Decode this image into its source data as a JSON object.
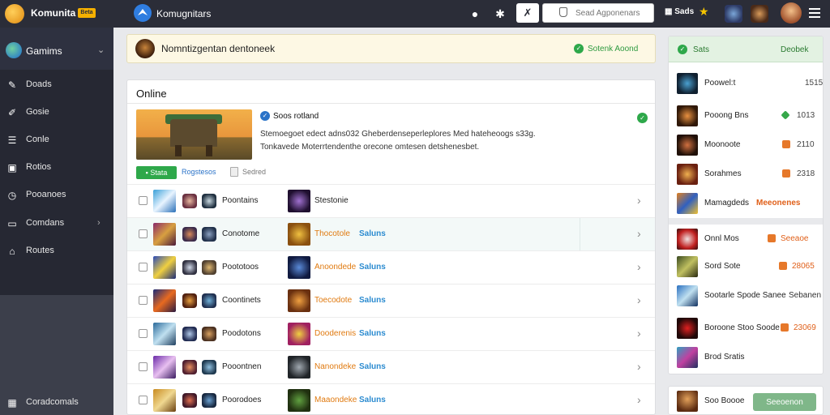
{
  "topbar": {
    "brand": "Komunita",
    "brand_badge": "Beta",
    "app_title": "Komugnitars",
    "search_placeholder": "Sead Agponenars",
    "stats_label": "Sads"
  },
  "sidebar": {
    "header_label": "Gamims",
    "items": [
      {
        "label": "Doads"
      },
      {
        "label": "Gosie"
      },
      {
        "label": "Conle"
      },
      {
        "label": "Rotios"
      },
      {
        "label": "Pooanoes"
      },
      {
        "label": "Comdans"
      },
      {
        "label": "Routes"
      }
    ],
    "footer_label": "Coradcomals"
  },
  "banner": {
    "text": "Nomntizgentan dentoneek",
    "status": "Sotenk Aoond"
  },
  "panel": {
    "title": "Online",
    "hero": {
      "title": "Soos rotland",
      "desc_line1": "Stemoegoet edect adns032 Gheberdenseperleplores Med hateheoogs s33g.",
      "desc_line2": "Tonkavede Moterrtendenthe orecone omtesen detshenesbet.",
      "button_label": "Stata",
      "link1": "Rogstesos",
      "link2": "Sedred"
    },
    "rows": [
      {
        "name": "Poontains",
        "category": "Stestonie",
        "tag": ""
      },
      {
        "name": "Conotome",
        "category": "Thocotole",
        "tag": "Saluns"
      },
      {
        "name": "Poototoos",
        "category": "Anoondede",
        "tag": "Saluns"
      },
      {
        "name": "Coontinets",
        "category": "Toecodote",
        "tag": "Saluns"
      },
      {
        "name": "Poodotons",
        "category": "Dooderenis",
        "tag": "Saluns"
      },
      {
        "name": "Pooontnen",
        "category": "Nanondeke",
        "tag": "Saluns"
      },
      {
        "name": "Poorodoes",
        "category": "Maaondeke",
        "tag": "Saluns"
      }
    ]
  },
  "right_panel": {
    "head_label": "Sats",
    "head_action": "Deobek",
    "items": [
      {
        "label": "Poowel:t",
        "value": "1515"
      },
      {
        "label": "Pooong Bns",
        "value": "1013"
      },
      {
        "label": "Moonoote",
        "value": "2110"
      },
      {
        "label": "Sorahmes",
        "value": "2318"
      },
      {
        "label": "Mamagdeds",
        "extra": "Meeonenes"
      },
      {
        "label": "Onnl Mos",
        "value": "Seeaoe"
      },
      {
        "label": "Sord Sote",
        "value": "28065"
      },
      {
        "label": "Sootarle Spode Sanee",
        "extra": "Sebanen"
      },
      {
        "label": "Boroone Stoo Soode",
        "value": "23069"
      },
      {
        "label": "Brod Sratis"
      }
    ],
    "footer": {
      "label": "Soo Boooe",
      "button_label": "Seeoenon"
    }
  }
}
